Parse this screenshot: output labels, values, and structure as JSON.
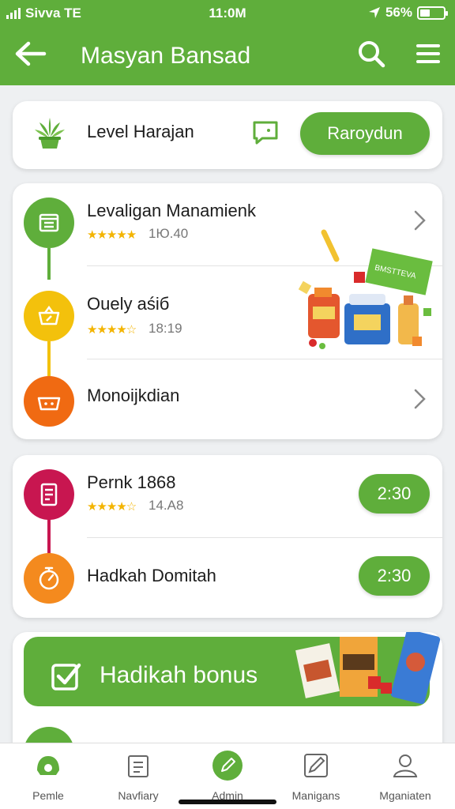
{
  "status": {
    "carrier": "Sivva TE",
    "time": "11:0M",
    "battery": "56%"
  },
  "header": {
    "title": "Masyan Bansad",
    "icons": [
      "back-arrow-icon",
      "search-icon",
      "menu-icon"
    ]
  },
  "level_card": {
    "label": "Level Harajan",
    "button": "Raroydun"
  },
  "list1": [
    {
      "title": "Levaligan Manamienk",
      "stars": "★★★★★",
      "rating": "1Ю.40"
    },
    {
      "title": "Ouely aśiб",
      "stars": "★★★★☆",
      "rating": "18:19"
    },
    {
      "title": "Monoijkdian"
    }
  ],
  "list2": [
    {
      "title": "Pernk 1868",
      "stars": "★★★★☆",
      "rating": "14.A8",
      "badge": "2:30"
    },
    {
      "title": "Hadkah Domitah",
      "badge": "2:30"
    }
  ],
  "bonus": {
    "title": "Hadikah bonus"
  },
  "promo_sign": "BMSTTEVA",
  "nav": [
    {
      "label": "Pemle",
      "icon": "home-icon"
    },
    {
      "label": "Navfiary",
      "icon": "calendar-icon"
    },
    {
      "label": "Admin",
      "icon": "pencil-icon"
    },
    {
      "label": "Manigans",
      "icon": "edit-icon"
    },
    {
      "label": "Mganiaten",
      "icon": "profile-icon"
    }
  ],
  "colors": {
    "primary": "#5fae3b",
    "green_icon": "#5fae3b",
    "yellow_icon": "#f3c10c",
    "orange_icon": "#f06a12",
    "crimson_icon": "#c81650",
    "orange2_icon": "#f48a1e"
  }
}
